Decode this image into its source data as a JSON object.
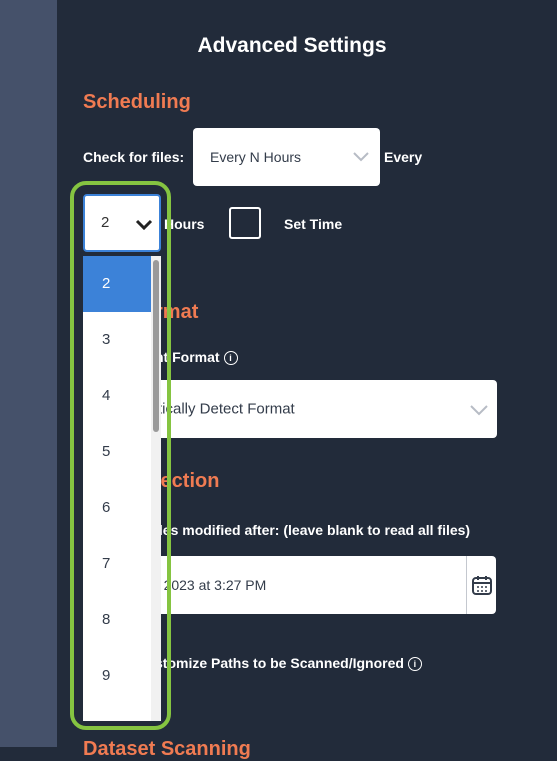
{
  "title": "Advanced Settings",
  "scheduling": {
    "heading": "Scheduling",
    "check_label": "Check for files:",
    "frequency_value": "Every N Hours",
    "every_label": "Every",
    "hours_value": "2",
    "hours_label": "Hours",
    "set_time_label": "Set Time",
    "hours_options": [
      "2",
      "3",
      "4",
      "5",
      "6",
      "7",
      "8",
      "9"
    ],
    "selected_option": "2"
  },
  "format": {
    "heading_partial": "rmat",
    "label_partial": "nt Format",
    "value_partial": "tically Detect Format"
  },
  "selection": {
    "heading_partial": "lection",
    "label_partial": "iles modified after: (leave blank to read all files)",
    "date_value_partial": "7, 2023 at 3:27 PM",
    "customize_partial": "stomize Paths to be Scanned/Ignored"
  },
  "bottom_heading_partial": "Dataset Scanning",
  "colors": {
    "background": "#222b3a",
    "accent": "#f07b52",
    "selected": "#3c82d8",
    "highlight": "#85c441"
  }
}
